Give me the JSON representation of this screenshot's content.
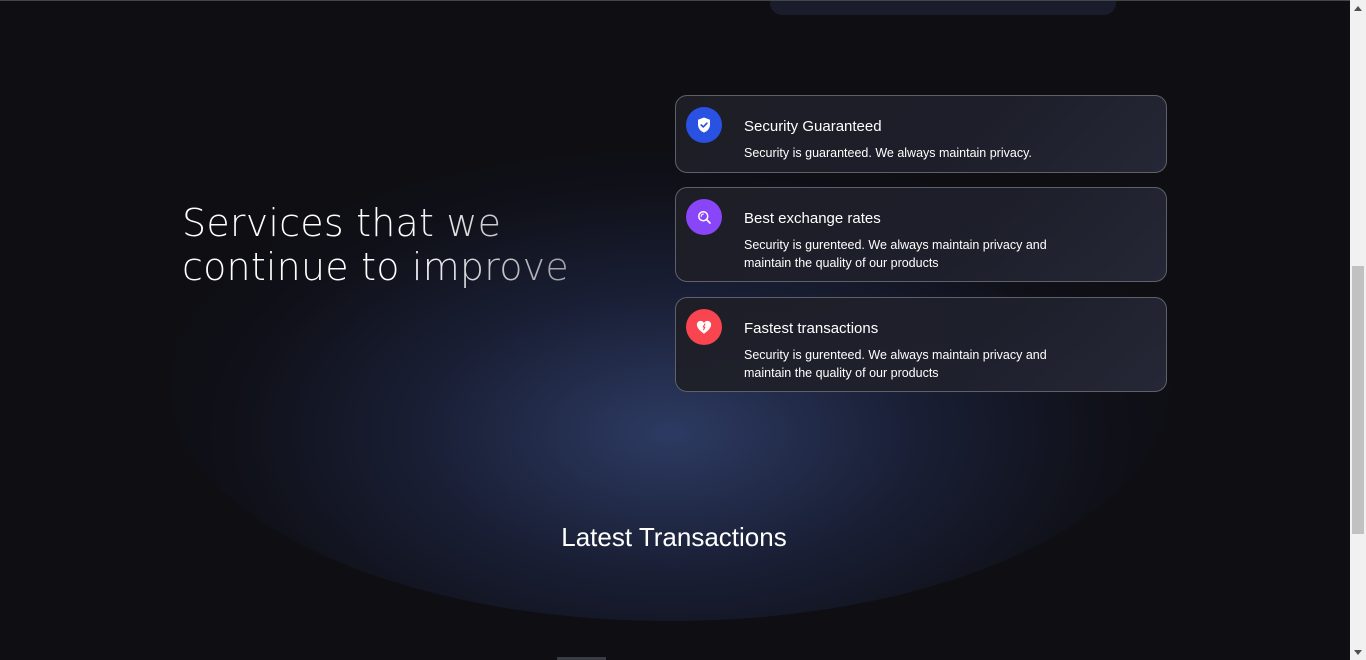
{
  "hero": {
    "headline_line1": "Services that we",
    "headline_line2": "continue to improve"
  },
  "services": [
    {
      "icon": "shield-check-icon",
      "icon_color": "#2952e3",
      "title": "Security Guaranteed",
      "description": "Security is guaranteed. We always maintain privacy."
    },
    {
      "icon": "search-icon",
      "icon_color": "#8945f8",
      "title": "Best exchange rates",
      "description": "Security is gurenteed. We always maintain privacy and maintain the quality of our products"
    },
    {
      "icon": "heart-icon",
      "icon_color": "#f84550",
      "title": "Fastest transactions",
      "description": "Security is gurenteed. We always maintain privacy and maintain the quality of our products"
    }
  ],
  "transactions_section": {
    "title": "Latest Transactions"
  },
  "colors": {
    "background": "#0e0e13",
    "glow": "#2b3a66",
    "card_border": "#5e606a"
  }
}
